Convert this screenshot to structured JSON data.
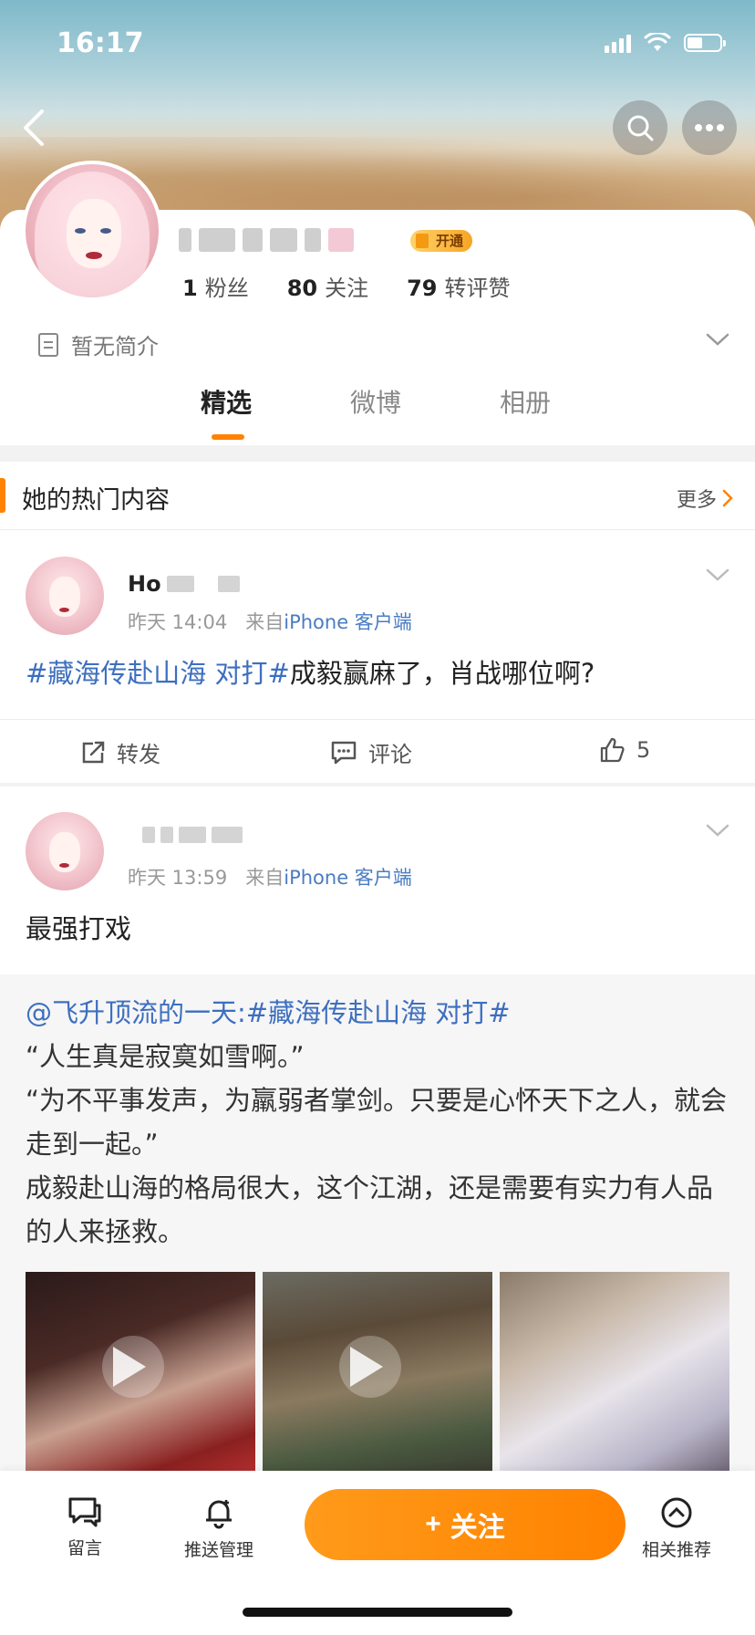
{
  "status_bar": {
    "time": "16:17"
  },
  "profile": {
    "vip_badge": "开通",
    "stats": [
      {
        "num": "1",
        "label": "粉丝"
      },
      {
        "num": "80",
        "label": "关注"
      },
      {
        "num": "79",
        "label": "转评赞"
      }
    ],
    "bio": "暂无简介",
    "tabs": [
      "精选",
      "微博",
      "相册"
    ]
  },
  "hot_section": {
    "title": "她的热门内容",
    "more": "更多"
  },
  "posts": [
    {
      "name": "Ho",
      "time": "昨天 14:04",
      "from_prefix": "来自",
      "source": "iPhone 客户端",
      "topic": "#藏海传赴山海 对打#",
      "text": "成毅赢麻了，肖战哪位啊?",
      "actions": {
        "repost": "转发",
        "comment": "评论",
        "like_count": "5"
      }
    },
    {
      "time": "昨天 13:59",
      "from_prefix": "来自",
      "source": "iPhone 客户端",
      "text": "最强打戏",
      "repost": {
        "author_topic": "@飞升顶流的一天:#藏海传赴山海 对打#",
        "lines": [
          "“人生真是寂寞如雪啊。”",
          "“为不平事发声，为羸弱者掌剑。只要是心怀天下之人，就会走到一起。”",
          "成毅赴山海的格局很大，这个江湖，还是需要有实力有人品的人来拯救。"
        ]
      }
    }
  ],
  "bottom_bar": {
    "message": "留言",
    "push": "推送管理",
    "follow": "关注",
    "follow_plus": "+",
    "related": "相关推荐"
  },
  "colors": {
    "accent": "#ff8200",
    "link": "#3d6fbf"
  }
}
